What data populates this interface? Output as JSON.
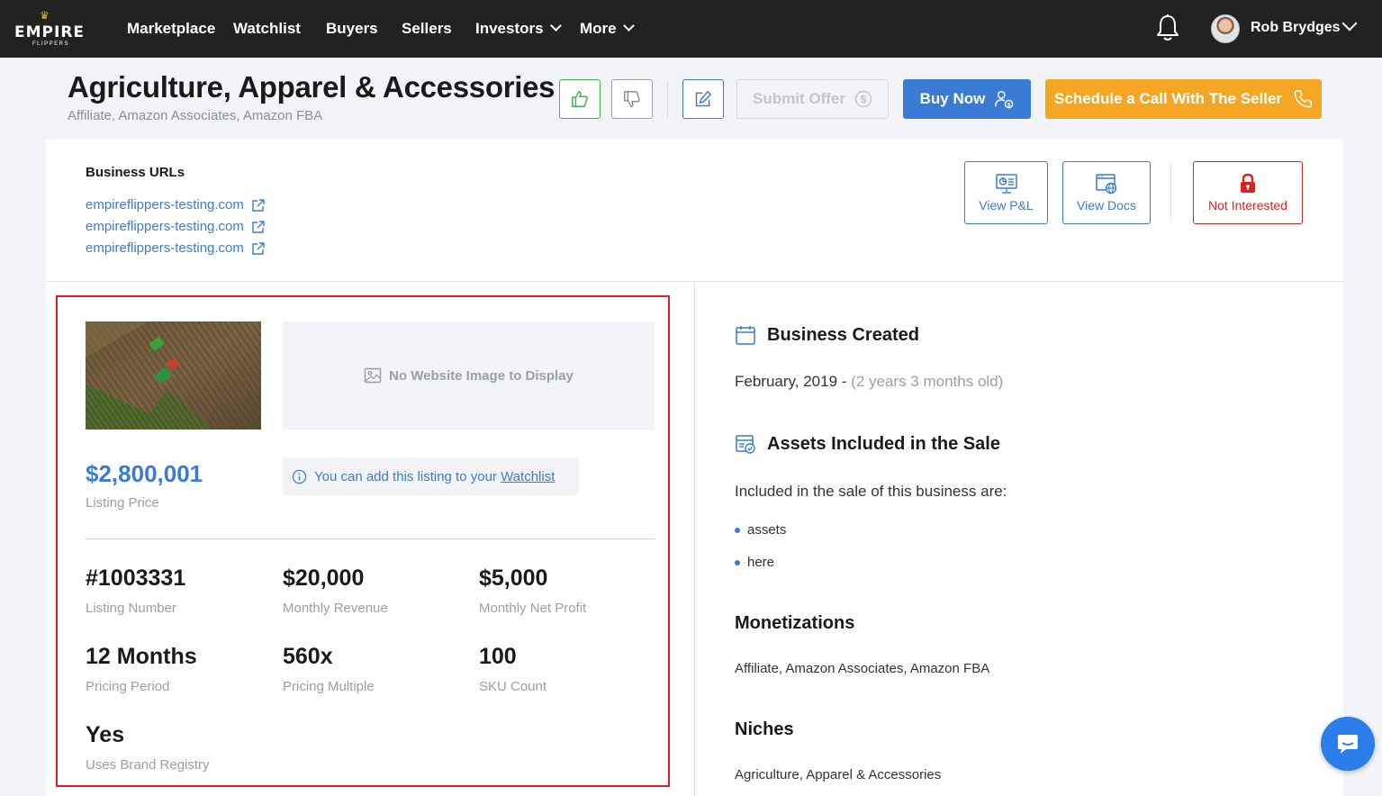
{
  "nav": {
    "logo_text": "EMPIRE",
    "logo_sub": "FLIPPERS",
    "items": [
      "Marketplace",
      "Watchlist",
      "Buyers",
      "Sellers",
      "Investors",
      "More"
    ],
    "user_name": "Rob Brydges"
  },
  "header": {
    "title": "Agriculture, Apparel & Accessories",
    "subtitle": "Affiliate, Amazon Associates, Amazon FBA",
    "submit_offer": "Submit Offer",
    "buy_now": "Buy Now",
    "schedule_call": "Schedule a Call With The Seller"
  },
  "urls": {
    "title": "Business URLs",
    "items": [
      "empireflippers-testing.com",
      "empireflippers-testing.com",
      "empireflippers-testing.com"
    ]
  },
  "actions": {
    "view_pl": "View P&L",
    "view_docs": "View Docs",
    "not_interested": "Not Interested"
  },
  "listing": {
    "no_image_text": "No Website Image to Display",
    "price": "$2,800,001",
    "price_label": "Listing Price",
    "watch_note_prefix": "You can add this listing to your",
    "watch_note_link": "Watchlist",
    "stats": [
      {
        "value": "#1003331",
        "label": "Listing Number"
      },
      {
        "value": "$20,000",
        "label": "Monthly Revenue"
      },
      {
        "value": "$5,000",
        "label": "Monthly Net Profit"
      },
      {
        "value": "12 Months",
        "label": "Pricing Period"
      },
      {
        "value": "560x",
        "label": "Pricing Multiple"
      },
      {
        "value": "100",
        "label": "SKU Count"
      },
      {
        "value": "Yes",
        "label": "Uses Brand Registry"
      }
    ]
  },
  "details": {
    "created_title": "Business Created",
    "created_date": "February, 2019 -",
    "created_age": "(2 years 3 months old)",
    "assets_title": "Assets Included in the Sale",
    "assets_intro": "Included in the sale of this business are:",
    "assets": [
      "assets",
      "here"
    ],
    "monetizations_title": "Monetizations",
    "monetizations": "Affiliate, Amazon Associates, Amazon FBA",
    "niches_title": "Niches",
    "niches": "Agriculture, Apparel & Accessories"
  },
  "colors": {
    "primary": "#3a7bd5",
    "accent": "#f5a623",
    "danger": "#e02020",
    "success": "#3bb54a",
    "navbar": "#222222"
  }
}
